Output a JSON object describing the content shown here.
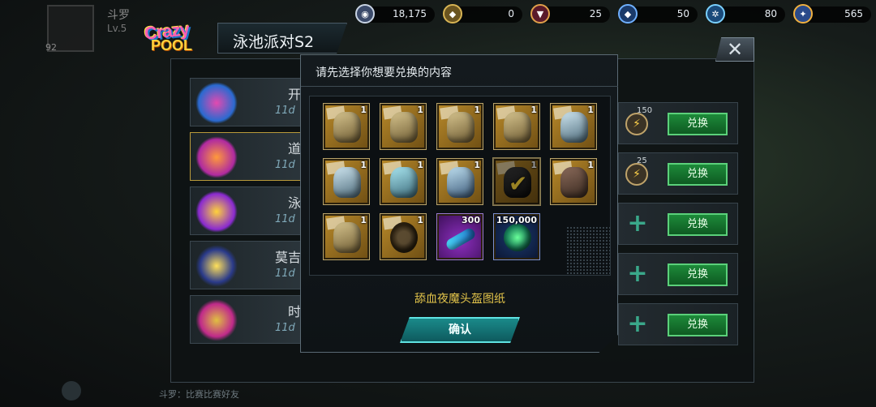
{
  "currencies": [
    {
      "icon": "coin-icon",
      "value": "18,175"
    },
    {
      "icon": "gold-badge-icon",
      "value": "0"
    },
    {
      "icon": "red-gem-icon",
      "value": "25"
    },
    {
      "icon": "blue-gem-icon",
      "value": "50"
    },
    {
      "icon": "gear-token-icon",
      "value": "80"
    },
    {
      "icon": "medal-icon",
      "value": "565"
    }
  ],
  "player": {
    "name": "斗罗",
    "level": "Lv.5",
    "number": "92"
  },
  "event": {
    "logo_line1": "Crazy",
    "logo_line2": "POOL",
    "title": "泳池派对S2"
  },
  "list": [
    {
      "name": "开",
      "time": "11d"
    },
    {
      "name": "道",
      "time": "11d"
    },
    {
      "name": "泳",
      "time": "11d"
    },
    {
      "name": "莫吉",
      "time": "11d"
    },
    {
      "name": "时",
      "time": "11d"
    }
  ],
  "right_rows": [
    {
      "badge": "150",
      "button": "兑换"
    },
    {
      "badge": "25",
      "button": "兑换"
    },
    {
      "button": "兑换"
    },
    {
      "button": "兑换"
    },
    {
      "button": "兑换"
    }
  ],
  "modal": {
    "title": "请先选择你想要兑换的内容",
    "items": [
      {
        "count": "1"
      },
      {
        "count": "1"
      },
      {
        "count": "1"
      },
      {
        "count": "1"
      },
      {
        "count": "1"
      },
      {
        "count": "1"
      },
      {
        "count": "1"
      },
      {
        "count": "1"
      },
      {
        "count": "1"
      },
      {
        "count": "1"
      },
      {
        "count": "1"
      },
      {
        "count": "1"
      },
      {
        "count": "300"
      },
      {
        "count": "150,000"
      }
    ],
    "selected_name": "舔血夜魔头盔图纸",
    "confirm_label": "确认"
  },
  "bottom": {
    "chat_text": "斗罗：比赛比赛好友"
  }
}
